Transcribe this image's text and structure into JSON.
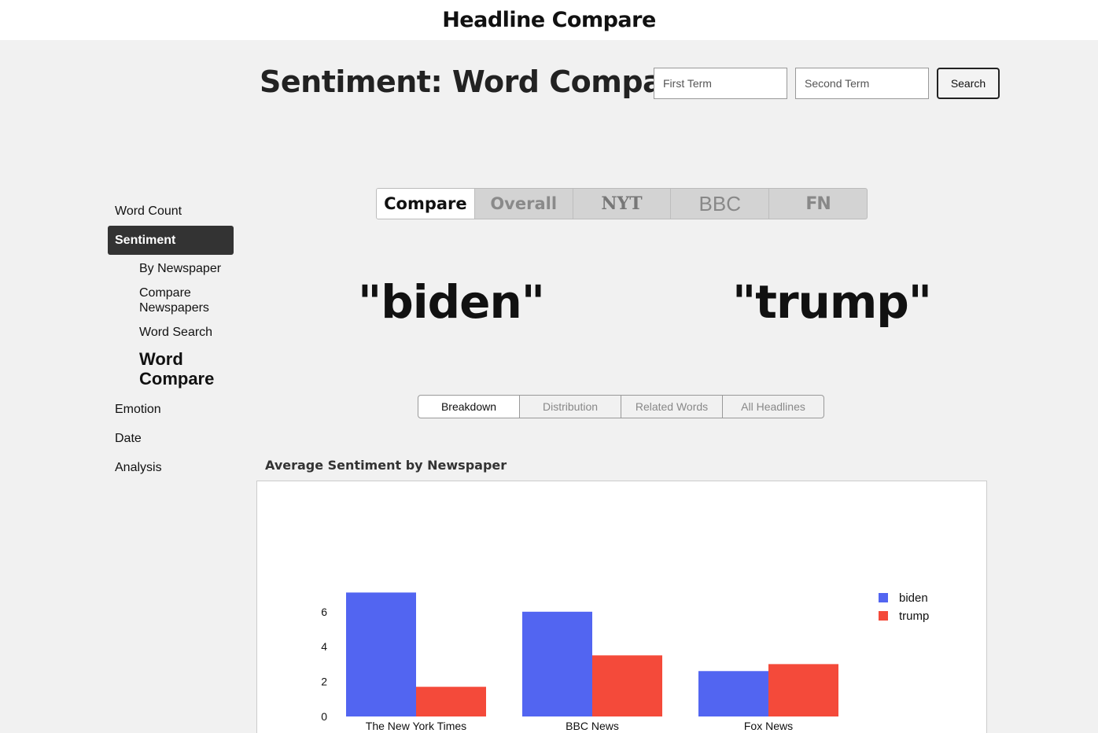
{
  "app": {
    "title": "Headline Compare"
  },
  "header": {
    "page_title": "Sentiment: Word Compare",
    "first_term_placeholder": "First Term",
    "second_term_placeholder": "Second Term",
    "search_label": "Search"
  },
  "sidebar": {
    "items": [
      {
        "label": "Word Count"
      },
      {
        "label": "Sentiment"
      },
      {
        "label": "Emotion"
      },
      {
        "label": "Date"
      },
      {
        "label": "Analysis"
      }
    ],
    "sentiment_subitems": [
      {
        "label": "By Newspaper"
      },
      {
        "label": "Compare Newspapers"
      },
      {
        "label": "Word Search"
      },
      {
        "label": "Word Compare"
      }
    ]
  },
  "tabs": [
    {
      "label": "Compare"
    },
    {
      "label": "Overall"
    },
    {
      "label": "NYT"
    },
    {
      "label": "BBC"
    },
    {
      "label": "FN"
    }
  ],
  "terms": {
    "first": "\"biden\"",
    "second": "\"trump\""
  },
  "subtabs": [
    {
      "label": "Breakdown"
    },
    {
      "label": "Distribution"
    },
    {
      "label": "Related Words"
    },
    {
      "label": "All Headlines"
    }
  ],
  "chart_data": {
    "type": "bar",
    "title": "Average Sentiment by Newspaper",
    "categories": [
      "The New York Times",
      "BBC News",
      "Fox News"
    ],
    "series": [
      {
        "name": "biden",
        "color": "#5265f1",
        "values": [
          7.1,
          6.0,
          2.6
        ]
      },
      {
        "name": "trump",
        "color": "#f44a3a",
        "values": [
          1.7,
          3.5,
          3.0
        ]
      }
    ],
    "yticks": [
      0,
      2,
      4,
      6
    ],
    "ylim": [
      0,
      7.5
    ],
    "legend_position": "right"
  }
}
